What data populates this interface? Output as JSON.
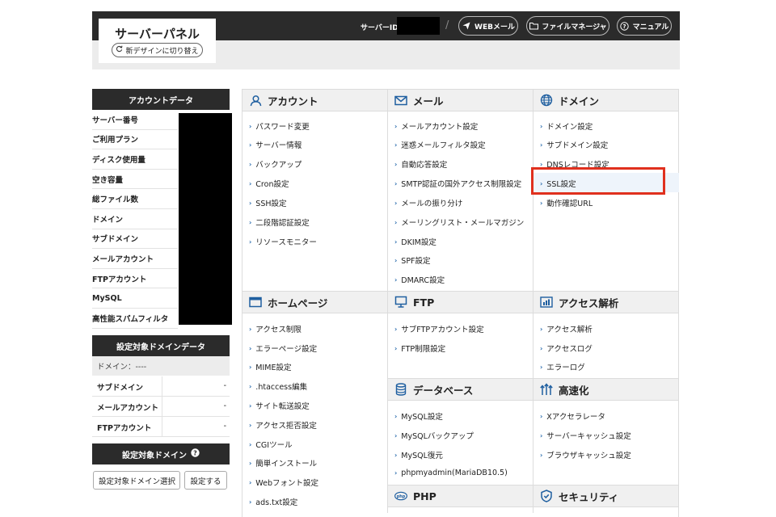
{
  "header": {
    "logo_title": "サーバーパネル",
    "design_switch": "新デザインに切り替え",
    "server_id_label": "サーバーID",
    "slash": "/",
    "buttons": [
      {
        "label": "WEBメール",
        "icon": "send-icon"
      },
      {
        "label": "ファイルマネージャ",
        "icon": "folder-icon"
      },
      {
        "label": "マニュアル",
        "icon": "help-icon"
      }
    ]
  },
  "account": {
    "title": "アカウントデータ",
    "rows": [
      "サーバー番号",
      "ご利用プラン",
      "ディスク使用量",
      "空き容量",
      "総ファイル数",
      "ドメイン",
      "サブドメイン",
      "メールアカウント",
      "FTPアカウント",
      "MySQL",
      "高性能スパムフィルタ"
    ]
  },
  "domain_data": {
    "title": "設定対象ドメインデータ",
    "domain_line": "ドメイン：----",
    "rows": [
      {
        "label": "サブドメイン",
        "value": "-"
      },
      {
        "label": "メールアカウント",
        "value": "-"
      },
      {
        "label": "FTPアカウント",
        "value": "-"
      }
    ]
  },
  "target_domain": {
    "title": "設定対象ドメイン",
    "select_value": "設定対象ドメイン選択",
    "button": "設定する"
  },
  "sections": {
    "account": {
      "title": "アカウント",
      "items": [
        "パスワード変更",
        "サーバー情報",
        "バックアップ",
        "Cron設定",
        "SSH設定",
        "二段階認証設定",
        "リソースモニター"
      ]
    },
    "mail": {
      "title": "メール",
      "items": [
        "メールアカウント設定",
        "迷惑メールフィルタ設定",
        "自動応答設定",
        "SMTP認証の国外アクセス制限設定",
        "メールの振り分け",
        "メーリングリスト・メールマガジン",
        "DKIM設定",
        "SPF設定",
        "DMARC設定"
      ]
    },
    "domain": {
      "title": "ドメイン",
      "items": [
        "ドメイン設定",
        "サブドメイン設定",
        "DNSレコード設定",
        "SSL設定",
        "動作確認URL"
      ]
    },
    "homepage": {
      "title": "ホームページ",
      "items": [
        "アクセス制限",
        "エラーページ設定",
        "MIME設定",
        ".htaccess編集",
        "サイト転送設定",
        "アクセス拒否設定",
        "CGIツール",
        "簡単インストール",
        "Webフォント設定",
        "ads.txt設定"
      ]
    },
    "ftp": {
      "title": "FTP",
      "items": [
        "サブFTPアカウント設定",
        "FTP制限設定"
      ]
    },
    "access": {
      "title": "アクセス解析",
      "items": [
        "アクセス解析",
        "アクセスログ",
        "エラーログ"
      ]
    },
    "database": {
      "title": "データベース",
      "items": [
        "MySQL設定",
        "MySQLバックアップ",
        "MySQL復元",
        "phpmyadmin(MariaDB10.5)"
      ]
    },
    "speed": {
      "title": "高速化",
      "items": [
        "Xアクセラレータ",
        "サーバーキャッシュ設定",
        "ブラウザキャッシュ設定"
      ]
    },
    "php": {
      "title": "PHP",
      "items": []
    },
    "security": {
      "title": "セキュリティ",
      "items": []
    }
  },
  "colors": {
    "dark": "#2b2b2b",
    "link_chevron": "#2266aa",
    "icon_blue": "#1f5fa0",
    "highlight": "#e0301e"
  }
}
